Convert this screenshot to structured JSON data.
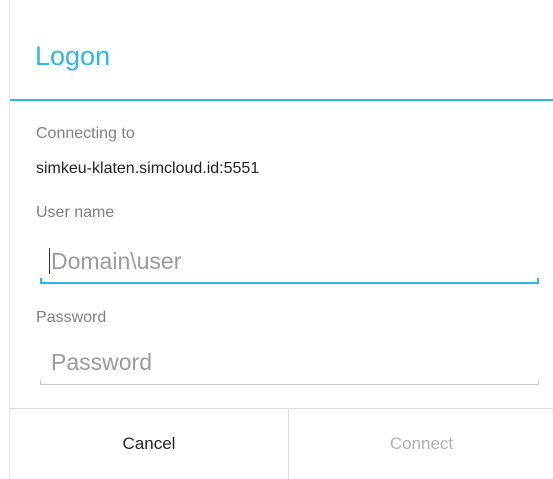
{
  "dialog": {
    "title": "Logon",
    "accent_color": "#33b5e5"
  },
  "connection": {
    "label": "Connecting to",
    "host": "simkeu-klaten.simcloud.id:5551"
  },
  "username": {
    "label": "User name",
    "placeholder": "Domain\\user",
    "value": "",
    "focused": true
  },
  "password": {
    "label": "Password",
    "placeholder": "Password",
    "value": ""
  },
  "buttons": {
    "cancel": "Cancel",
    "connect": "Connect",
    "connect_enabled": false
  }
}
